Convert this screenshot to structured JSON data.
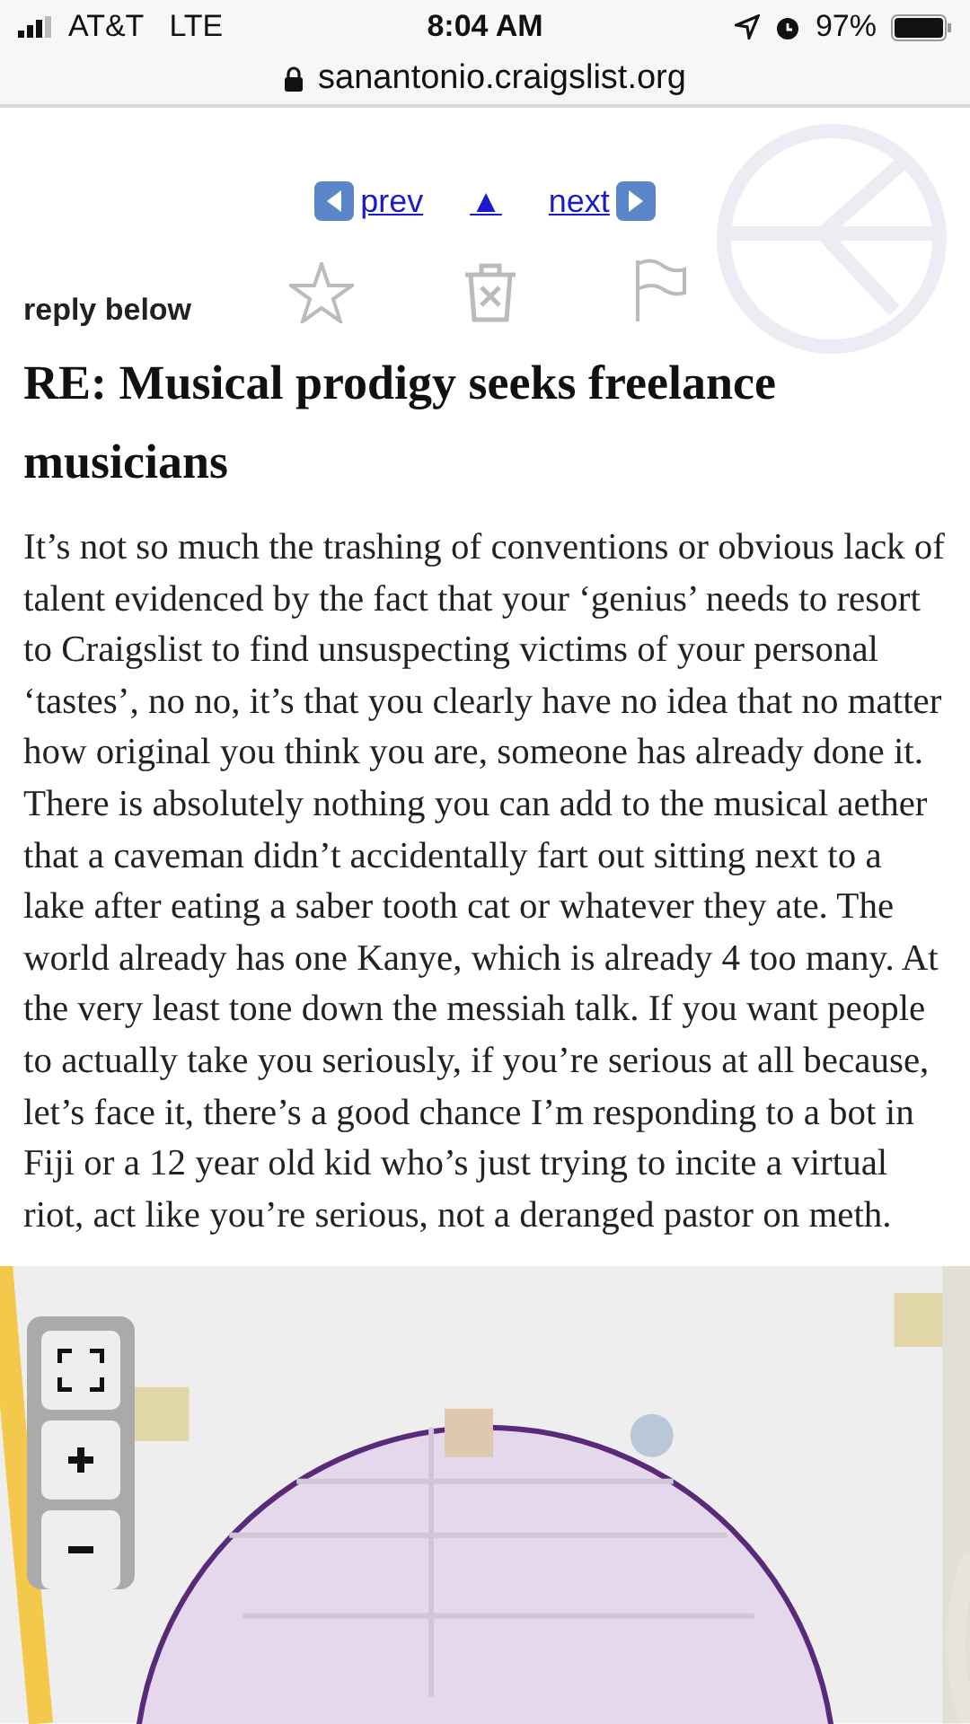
{
  "status_bar": {
    "carrier": "AT&T",
    "network": "LTE",
    "time": "8:04 AM",
    "battery": "97%"
  },
  "address_bar": {
    "url": "sanantonio.craigslist.org"
  },
  "nav": {
    "prev": "prev",
    "up": "▲",
    "next": "next"
  },
  "reply_label": "reply below",
  "title": "RE: Musical prodigy seeks freelance musicians",
  "body": "It’s not so much the trashing of conventions or obvious lack of talent evidenced by the fact that your ‘genius’ needs to resort to Craigslist to find unsuspecting victims of your personal ‘tastes’, no no, it’s that you clearly have no idea that no matter how original you think you are, someone has already done it. There is absolutely nothing you can add to the musical aether that a caveman didn’t accidentally fart out sitting next to a lake after eating a saber tooth cat or whatever they ate. The world already has one Kanye, which is already 4 too many. At the very least tone down the messiah talk. If you want people to actually take you seriously, if you’re serious at all because, let’s face it, there’s a good chance I’m responding to a bot in Fiji or a 12 year old kid who’s just trying to incite a virtual riot, act like you’re serious, not a deranged pastor on meth."
}
